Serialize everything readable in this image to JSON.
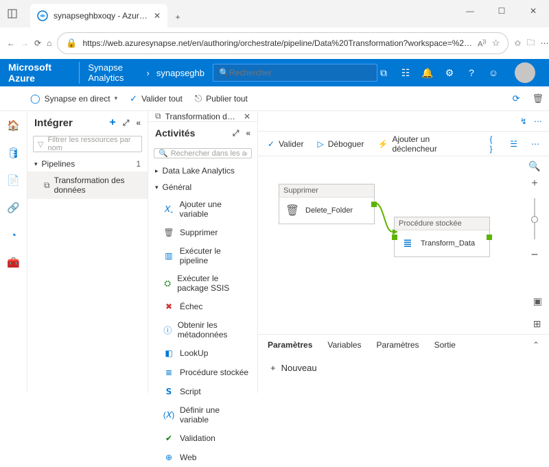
{
  "browser": {
    "tab_title": "synapseghbxoqy - Azure Synaps…",
    "url": "https://web.azuresynapse.net/en/authoring/orchestrate/pipeline/Data%20Transformation?workspace=%2…",
    "address_suffix_icons": [
      "A",
      "star-outline",
      "star",
      "collections"
    ]
  },
  "azure": {
    "brand": "Microsoft Azure",
    "crumb1": "Synapse Analytics",
    "crumb2": "synapseghb",
    "search_placeholder": "Rechercher"
  },
  "actionbar": {
    "live": "Synapse en direct",
    "validate_all": "Valider tout",
    "publish_all": "Publier tout"
  },
  "integrate": {
    "title": "Intégrer",
    "filter_placeholder": "Filtrer les ressources par nom",
    "pipelines_label": "Pipelines",
    "pipelines_count": "1",
    "pipeline_item": "Transformation des données"
  },
  "tabs": {
    "open_tab": "Transformation des données"
  },
  "activities": {
    "title": "Activités",
    "search_placeholder": "Rechercher dans les activités",
    "group_dla": "Data Lake Analytics",
    "group_general": "Général",
    "items": [
      {
        "label": "Ajouter une variable",
        "color": "#0078d4",
        "glyph": "𝑋₊"
      },
      {
        "label": "Supprimer",
        "color": "#605e5c",
        "glyph": "🗑"
      },
      {
        "label": "Exécuter le pipeline",
        "color": "#0078d4",
        "glyph": "▥"
      },
      {
        "label": "Exécuter le package SSIS",
        "color": "#107c10",
        "glyph": "⛭"
      },
      {
        "label": "Échec",
        "color": "#d13438",
        "glyph": "✖"
      },
      {
        "label": "Obtenir les métadonnées",
        "color": "#0078d4",
        "glyph": "ⓘ"
      },
      {
        "label": "LookUp",
        "color": "#0078d4",
        "glyph": "◧"
      },
      {
        "label": "Procédure stockée",
        "color": "#0078d4",
        "glyph": "≣"
      },
      {
        "label": "Script",
        "color": "#0078d4",
        "glyph": "𝗦"
      },
      {
        "label": "Définir une variable",
        "color": "#0078d4",
        "glyph": "(𝑋)"
      },
      {
        "label": "Validation",
        "color": "#107c10",
        "glyph": "✔"
      },
      {
        "label": "Web",
        "color": "#0078d4",
        "glyph": "⊕"
      }
    ]
  },
  "canvas_toolbar": {
    "validate": "Valider",
    "debug": "Déboguer",
    "trigger": "Ajouter un déclencheur"
  },
  "nodes": {
    "n1": {
      "type": "Supprimer",
      "name": "Delete_Folder"
    },
    "n2": {
      "type": "Procédure stockée",
      "name": "Transform_Data"
    }
  },
  "bottom": {
    "tabs": [
      "Paramètres",
      "Variables",
      "Paramètres",
      "Sortie"
    ],
    "new": "Nouveau"
  }
}
